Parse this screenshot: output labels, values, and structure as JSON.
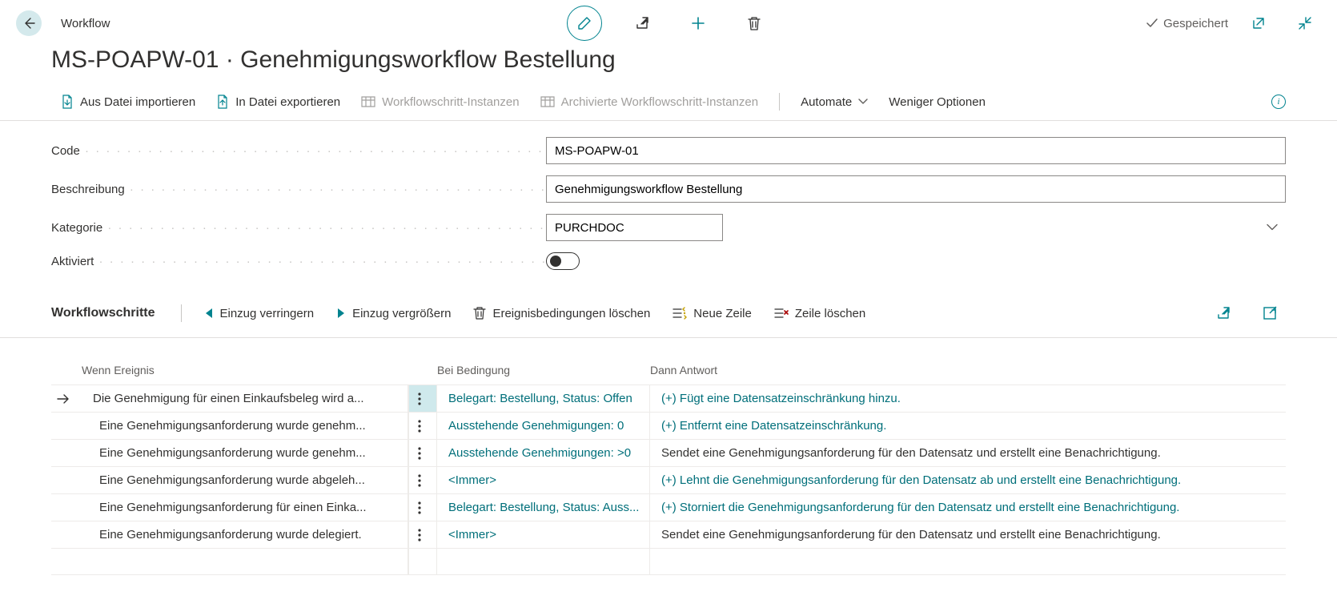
{
  "header": {
    "crumb": "Workflow",
    "saved_label": "Gespeichert"
  },
  "page_title": "MS-POAPW-01 · Genehmigungsworkflow Bestellung",
  "toolbar": {
    "import_label": "Aus Datei importieren",
    "export_label": "In Datei exportieren",
    "step_instances_label": "Workflowschritt-Instanzen",
    "archived_step_instances_label": "Archivierte Workflowschritt-Instanzen",
    "automate_label": "Automate",
    "fewer_options_label": "Weniger Optionen"
  },
  "form": {
    "code_label": "Code",
    "code_value": "MS-POAPW-01",
    "description_label": "Beschreibung",
    "description_value": "Genehmigungsworkflow Bestellung",
    "category_label": "Kategorie",
    "category_value": "PURCHDOC",
    "activated_label": "Aktiviert"
  },
  "section": {
    "title": "Workflowschritte",
    "decrease_indent": "Einzug verringern",
    "increase_indent": "Einzug vergrößern",
    "delete_conditions": "Ereignisbedingungen löschen",
    "new_line": "Neue Zeile",
    "delete_line": "Zeile löschen"
  },
  "grid": {
    "headers": {
      "event": "Wenn Ereignis",
      "condition": "Bei Bedingung",
      "response": "Dann Antwort"
    },
    "rows": [
      {
        "selected": true,
        "indent": 1,
        "event": "Die Genehmigung für einen Einkaufsbeleg wird a...",
        "condition": "Belegart: Bestellung, Status: Offen",
        "condition_link": true,
        "response": "(+) Fügt eine Datensatzeinschränkung hinzu.",
        "response_link": true
      },
      {
        "indent": 2,
        "event": "Eine Genehmigungsanforderung wurde genehm...",
        "condition": "Ausstehende Genehmigungen: 0",
        "condition_link": true,
        "response": "(+) Entfernt eine Datensatzeinschränkung.",
        "response_link": true
      },
      {
        "indent": 2,
        "event": "Eine Genehmigungsanforderung wurde genehm...",
        "condition": "Ausstehende Genehmigungen: >0",
        "condition_link": true,
        "response": "Sendet eine Genehmigungsanforderung für den Datensatz und erstellt eine Benachrichtigung.",
        "response_link": false
      },
      {
        "indent": 2,
        "event": "Eine Genehmigungsanforderung wurde abgeleh...",
        "condition": "<Immer>",
        "condition_link": true,
        "response": "(+) Lehnt die Genehmigungsanforderung für den Datensatz ab und erstellt eine Benachrichtigung.",
        "response_link": true
      },
      {
        "indent": 2,
        "event": "Eine Genehmigungsanforderung für einen Einka...",
        "condition": "Belegart: Bestellung, Status: Auss...",
        "condition_link": true,
        "response": "(+) Storniert die Genehmigungsanforderung für den Datensatz und erstellt eine Benachrichtigung.",
        "response_link": true
      },
      {
        "indent": 2,
        "event": "Eine Genehmigungsanforderung wurde delegiert.",
        "condition": "<Immer>",
        "condition_link": true,
        "response": "Sendet eine Genehmigungsanforderung für den Datensatz und erstellt eine Benachrichtigung.",
        "response_link": false
      }
    ]
  }
}
